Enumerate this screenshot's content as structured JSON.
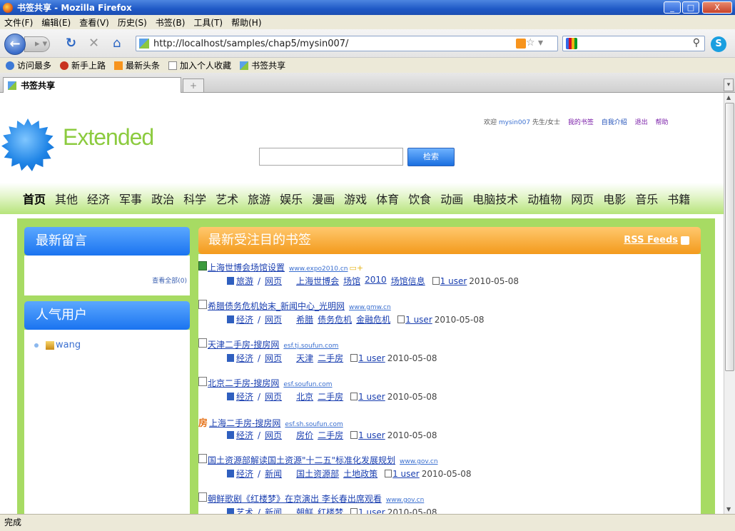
{
  "window": {
    "title": "书签共享 - Mozilla Firefox",
    "minimize": "_",
    "maximize": "□",
    "close": "X"
  },
  "menu": [
    "文件(F)",
    "编辑(E)",
    "查看(V)",
    "历史(S)",
    "书签(B)",
    "工具(T)",
    "帮助(H)"
  ],
  "toolbar": {
    "url": "http://localhost/samples/chap5/mysin007/"
  },
  "bookmarks_bar": [
    "访问最多",
    "新手上路",
    "最新头条",
    "加入个人收藏",
    "书签共享"
  ],
  "tab": {
    "label": "书签共享"
  },
  "site": {
    "logo": "Extended",
    "welcome": "欢迎",
    "username": "mysin007",
    "honorific": "先生/女士",
    "links": [
      "我的书签",
      "自我介绍",
      "退出",
      "帮助"
    ],
    "search_button": "检索"
  },
  "categories": [
    "首页",
    "其他",
    "经济",
    "军事",
    "政治",
    "科学",
    "艺术",
    "旅游",
    "娱乐",
    "漫画",
    "游戏",
    "体育",
    "饮食",
    "动画",
    "电脑技术",
    "动植物",
    "网页",
    "电影",
    "音乐",
    "书籍"
  ],
  "sidebar": {
    "latest_comments": {
      "title": "最新留言",
      "view_all": "查看全部(0)"
    },
    "popular_users": {
      "title": "人气用户",
      "users": [
        "wang"
      ]
    }
  },
  "main": {
    "title": "最新受注目的书签",
    "rss": "RSS Feeds",
    "entries": [
      {
        "icon": "green",
        "title": "上海世博会场馆设置",
        "domain": "www.expo2010.cn",
        "folder": "+",
        "categories": [
          "旅游",
          "网页"
        ],
        "tags": [
          "上海世博会",
          "场馆",
          "2010",
          "场馆信息"
        ],
        "users": "1 user",
        "date": "2010-05-08"
      },
      {
        "icon": "doc",
        "title": "希腊债务危机始末_新闻中心_光明网",
        "domain": "www.gmw.cn",
        "categories": [
          "经济",
          "网页"
        ],
        "tags": [
          "希腊",
          "债务危机",
          "金融危机"
        ],
        "users": "1 user",
        "date": "2010-05-08"
      },
      {
        "icon": "doc",
        "title": "天津二手房-搜房网",
        "domain": "esf.tj.soufun.com",
        "categories": [
          "经济",
          "网页"
        ],
        "tags": [
          "天津",
          "二手房"
        ],
        "users": "1 user",
        "date": "2010-05-08"
      },
      {
        "icon": "doc",
        "title": "北京二手房-搜房网",
        "domain": "esf.soufun.com",
        "categories": [
          "经济",
          "网页"
        ],
        "tags": [
          "北京",
          "二手房"
        ],
        "users": "1 user",
        "date": "2010-05-08"
      },
      {
        "icon": "orange",
        "title": "上海二手房-搜房网",
        "domain": "esf.sh.soufun.com",
        "categories": [
          "经济",
          "网页"
        ],
        "tags": [
          "房价",
          "二手房"
        ],
        "users": "1 user",
        "date": "2010-05-08"
      },
      {
        "icon": "doc",
        "title": "国土资源部解读国土资源\"十二五\"标准化发展规划",
        "domain": "www.gov.cn",
        "categories": [
          "经济",
          "新闻"
        ],
        "tags": [
          "国土资源部",
          "土地政策"
        ],
        "users": "1 user",
        "date": "2010-05-08"
      },
      {
        "icon": "doc",
        "title": "朝鲜歌剧《红楼梦》在京演出 李长春出席观看",
        "domain": "www.gov.cn",
        "categories": [
          "艺术",
          "新闻"
        ],
        "tags": [
          "朝鲜",
          "红楼梦"
        ],
        "users": "1 user",
        "date": "2010-05-08"
      }
    ]
  },
  "status": "完成"
}
